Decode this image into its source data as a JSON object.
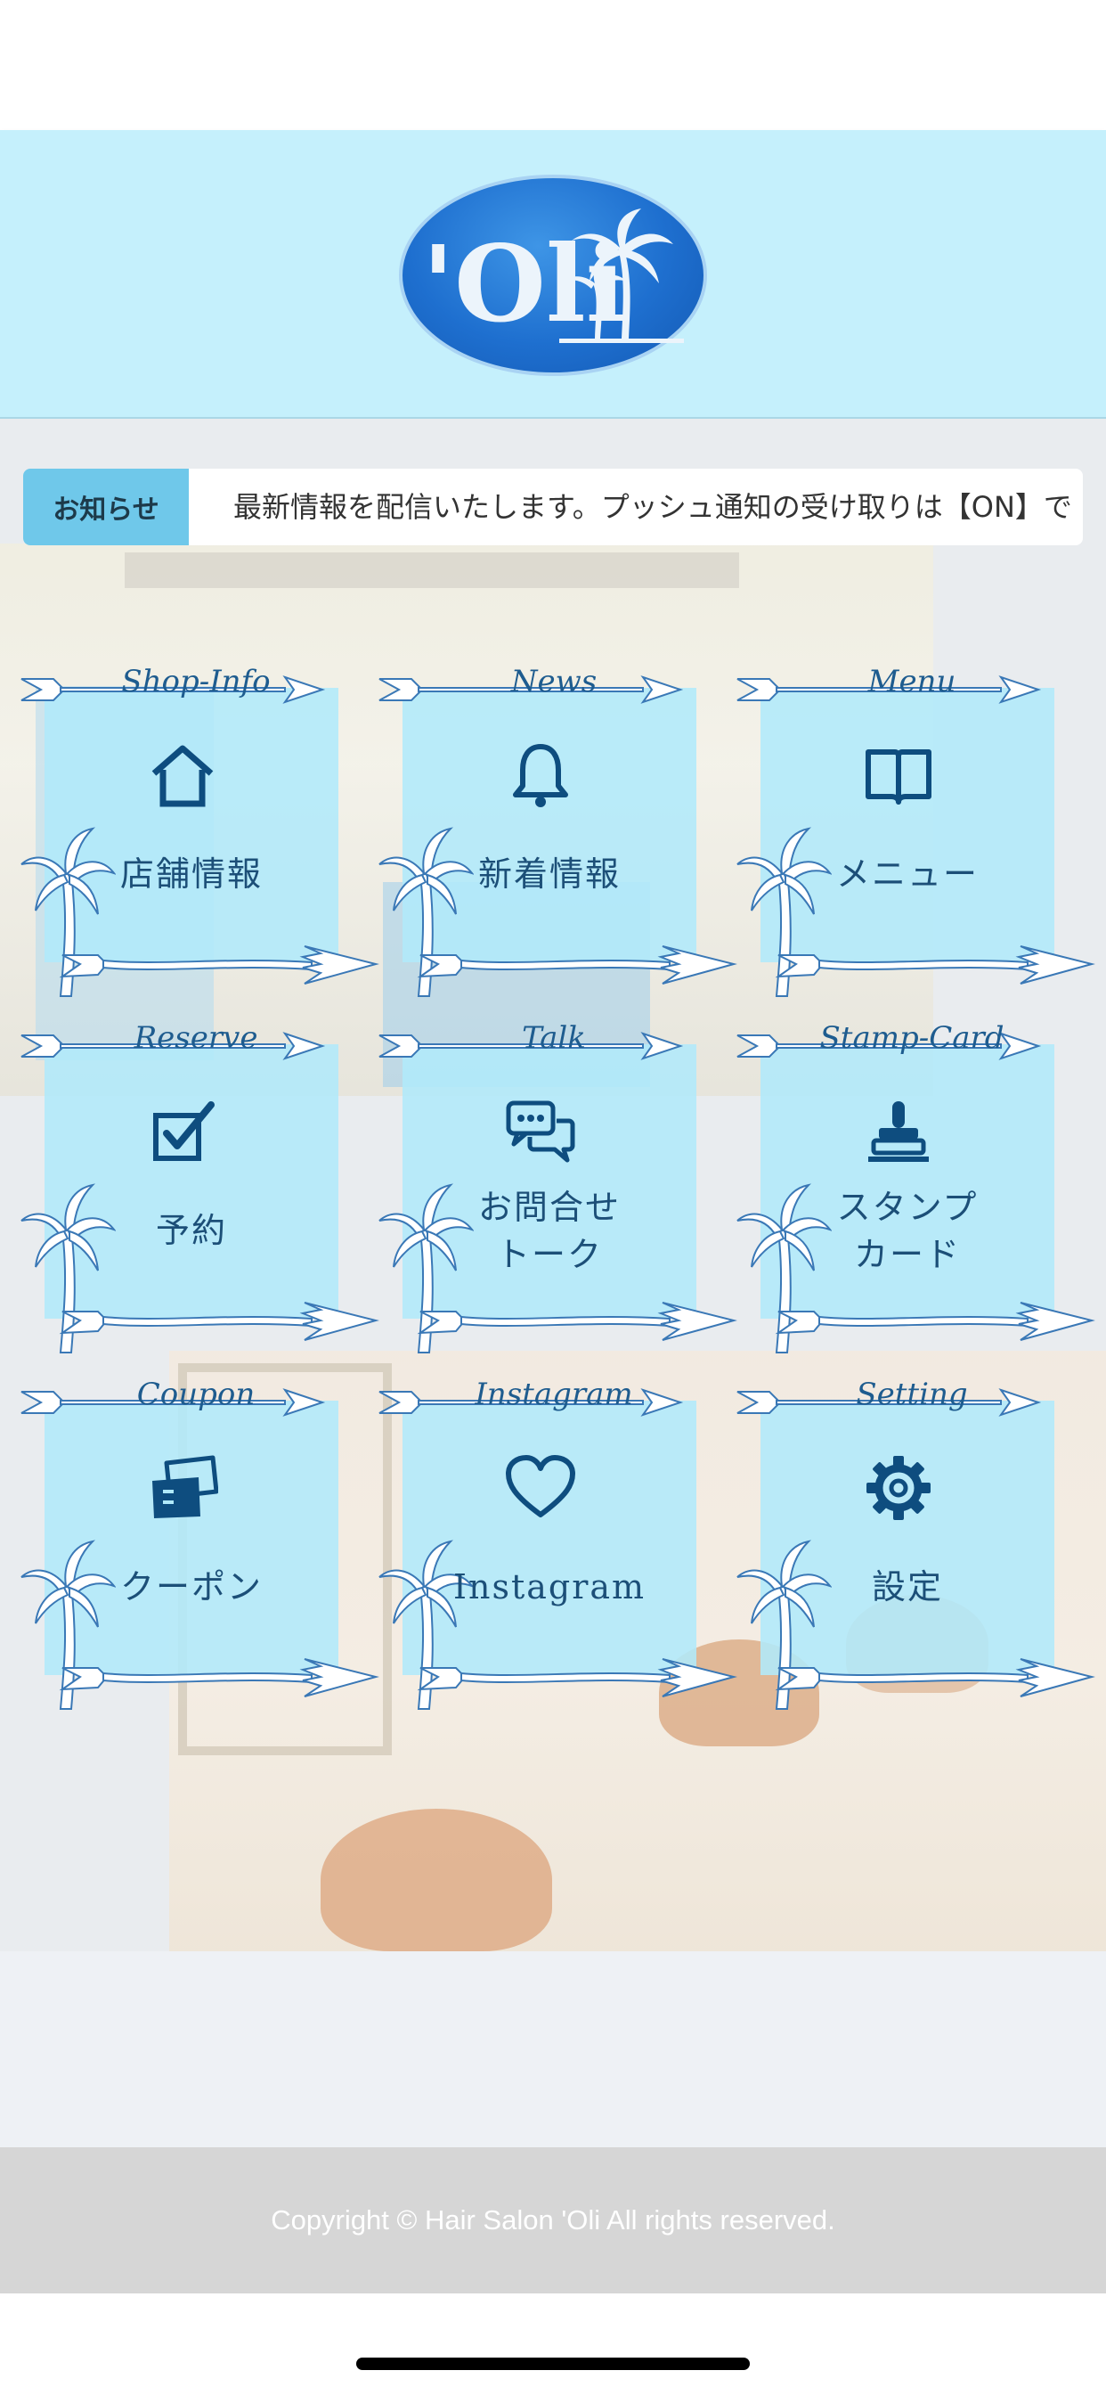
{
  "header": {
    "logo_text": "'Oli"
  },
  "notice": {
    "tag": "お知らせ",
    "text": "最新情報を配信いたします。プッシュ通知の受け取りは【ON】で"
  },
  "menu": [
    {
      "en": "Shop-Info",
      "label": "店舗情報",
      "icon": "house-icon"
    },
    {
      "en": "News",
      "label": "新着情報",
      "icon": "bell-icon"
    },
    {
      "en": "Menu",
      "label": "メニュー",
      "icon": "book-icon"
    },
    {
      "en": "Reserve",
      "label": "予約",
      "icon": "checkbox-icon"
    },
    {
      "en": "Talk",
      "label": "お問合せ\nトーク",
      "icon": "chat-bubbles-icon"
    },
    {
      "en": "Stamp-Card",
      "label": "スタンプ\nカード",
      "icon": "stamp-icon"
    },
    {
      "en": "Coupon",
      "label": "クーポン",
      "icon": "coupon-icon"
    },
    {
      "en": "Instagram",
      "label": "Instagram",
      "icon": "heart-icon"
    },
    {
      "en": "Setting",
      "label": "設定",
      "icon": "gear-icon"
    }
  ],
  "footer": {
    "copyright": "Copyright © Hair Salon 'Oli All rights reserved."
  },
  "colors": {
    "header_bg": "#c5f0fc",
    "tile_bg": "#b0e9fb",
    "notice_tag": "#6fc8ea",
    "icon_blue": "#0e4d7f",
    "footer_bg": "#d6d6d6"
  }
}
